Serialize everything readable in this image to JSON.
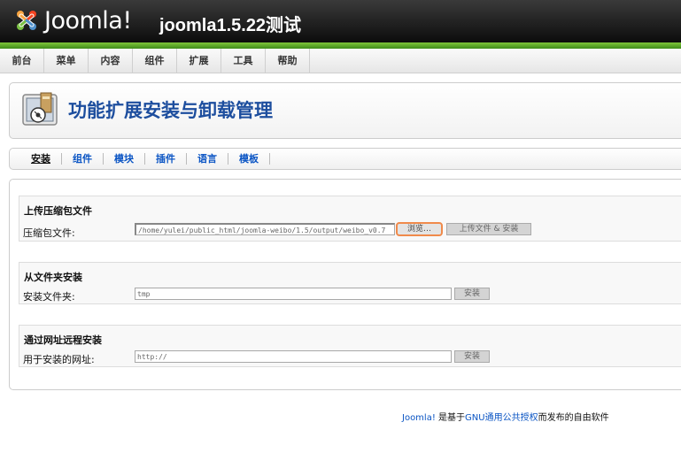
{
  "header": {
    "logo_text": "Joomla!",
    "site_title": "joomla1.5.22测试"
  },
  "menu": {
    "items": [
      "前台",
      "菜单",
      "内容",
      "组件",
      "扩展",
      "工具",
      "帮助"
    ]
  },
  "page": {
    "title": "功能扩展安装与卸载管理"
  },
  "subtabs": {
    "items": [
      "安装",
      "组件",
      "模块",
      "插件",
      "语言",
      "模板"
    ],
    "active_index": 0
  },
  "upload_section": {
    "title": "上传压缩包文件",
    "label": "压缩包文件:",
    "file_value": "/home/yulei/public_html/joomla-weibo/1.5/output/weibo_v0.7",
    "browse_label": "浏览…",
    "submit_label": "上传文件 & 安装"
  },
  "folder_section": {
    "title": "从文件夹安装",
    "label": "安装文件夹:",
    "value": "tmp",
    "submit_label": "安装"
  },
  "url_section": {
    "title": "通过网址远程安装",
    "label": "用于安装的网址:",
    "value": "http://",
    "submit_label": "安装"
  },
  "footer": {
    "joomla_link": "Joomla!",
    "text_1": " 是基于",
    "license_link": "GNU通用公共授权",
    "text_2": "而发布的自由软件"
  },
  "colors": {
    "header_bg": "#1a1a1a",
    "accent_green": "#5aa82a",
    "link_blue": "#0b55c4",
    "title_blue": "#1d4e9e"
  }
}
